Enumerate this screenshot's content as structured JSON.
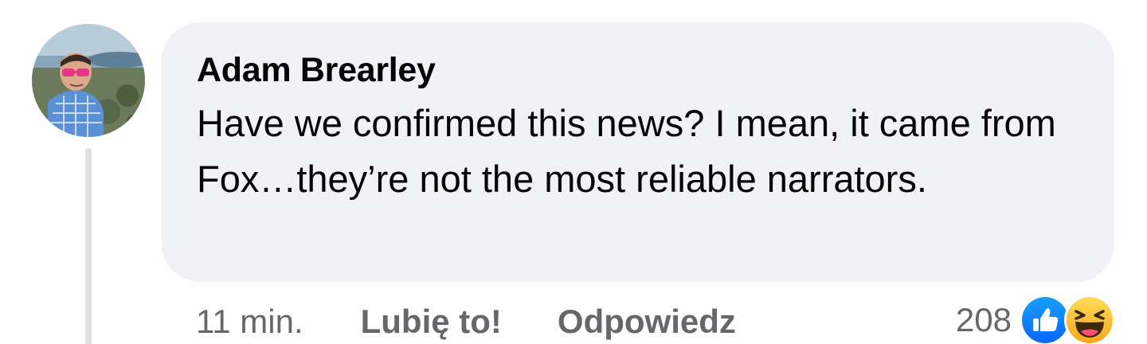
{
  "comment": {
    "author": "Adam Brearley",
    "text": "Have we confirmed this news? I mean, it came from Fox…they’re not the most reliable narrators.",
    "avatar": "avatar-photo"
  },
  "actions": {
    "time": "11 min.",
    "like_label": "Lubię to!",
    "reply_label": "Odpowiedz"
  },
  "reactions": {
    "count": "208",
    "icons": [
      "like-reaction-icon",
      "haha-reaction-icon"
    ]
  },
  "colors": {
    "bubble": "#f0f2f5",
    "text": "#050505",
    "secondary": "#65676b",
    "like_blue": "#1877f2",
    "haha_yellow": "#f7b125"
  }
}
